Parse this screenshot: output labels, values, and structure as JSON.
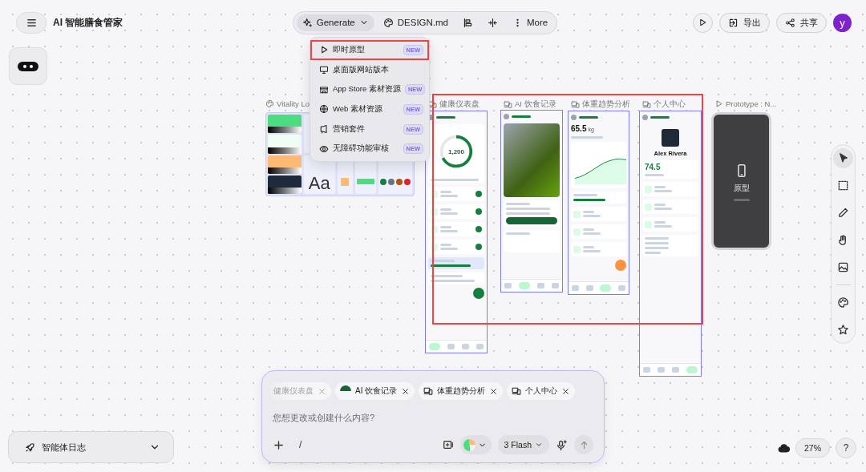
{
  "header": {
    "title": "AI 智能膳食管家"
  },
  "toolbar": [
    {
      "kind": "generate",
      "label": "Generate",
      "selected": true
    },
    {
      "kind": "file",
      "label": "DESIGN.md",
      "selected": false
    },
    {
      "kind": "align",
      "selected": false
    },
    {
      "kind": "split",
      "selected": false
    },
    {
      "kind": "more",
      "label": "More",
      "selected": false
    }
  ],
  "actions": [
    {
      "kind": "play"
    },
    {
      "kind": "export",
      "label": "导出"
    },
    {
      "kind": "share",
      "label": "共享"
    },
    {
      "kind": "avatar",
      "label": "y"
    }
  ],
  "generate_menu": [
    {
      "label": "即时原型",
      "badge": "NEW",
      "highlighted": true
    },
    {
      "label": "桌面版网站版本",
      "highlighted": false
    },
    {
      "label": "App Store 素材资源",
      "badge": "NEW",
      "highlighted": false
    },
    {
      "label": "Web 素材资源",
      "badge": "NEW",
      "highlighted": false
    },
    {
      "label": "营销套件",
      "badge": "NEW",
      "highlighted": false
    },
    {
      "label": "无障碍功能审核",
      "badge": "NEW",
      "highlighted": false
    }
  ],
  "canvas": {
    "design_board": {
      "title": "Vitality Lo",
      "type_samples": [
        "Aa"
      ],
      "swatches": [
        {
          "color": "#4ade80"
        },
        {
          "color": "#f0fdf4"
        },
        {
          "color": "#fdba74"
        },
        {
          "color": "#1e293b"
        }
      ],
      "status_dots": [
        {
          "color": "#15803d"
        },
        {
          "color": "#6b7280"
        },
        {
          "color": "#b45309"
        },
        {
          "color": "#dc2626"
        }
      ]
    },
    "screens": [
      {
        "kind": "dashboard",
        "title": "健康仪表盘",
        "selected": true,
        "value": "1,200",
        "nav": [
          {
            "selected": true
          },
          {
            "selected": false
          },
          {
            "selected": false
          },
          {
            "selected": false
          }
        ]
      },
      {
        "kind": "food",
        "title": "AI 饮食记录",
        "selected": true,
        "nav": [
          {
            "selected": false
          },
          {
            "selected": true
          },
          {
            "selected": false
          },
          {
            "selected": false
          }
        ]
      },
      {
        "kind": "weight",
        "title": "体重趋势分析",
        "selected": true,
        "value": "65.5",
        "unit": "kg",
        "nav": [
          {
            "selected": false
          },
          {
            "selected": false
          },
          {
            "selected": true
          },
          {
            "selected": false
          }
        ]
      },
      {
        "kind": "profile",
        "title": "个人中心",
        "selected": true,
        "name": "Alex Rivera",
        "value": "74.5",
        "nav": [
          {
            "selected": false
          },
          {
            "selected": false
          },
          {
            "selected": false
          },
          {
            "selected": true
          }
        ]
      },
      {
        "kind": "prototype",
        "title": "Prototype : N...",
        "selected": false,
        "label": "原型"
      }
    ]
  },
  "tools": [
    {
      "kind": "pointer",
      "selected": true
    },
    {
      "kind": "frame",
      "selected": false
    },
    {
      "kind": "pen",
      "selected": false
    },
    {
      "kind": "hand",
      "selected": false
    },
    {
      "kind": "image",
      "selected": false
    },
    {
      "kind": "palette",
      "selected": false
    },
    {
      "kind": "star",
      "selected": false
    }
  ],
  "agent_log": {
    "label": "智能体日志"
  },
  "composer": {
    "chips": [
      {
        "kind": "faded",
        "label": "健康仪表盘"
      },
      {
        "kind": "thumbnail",
        "label": "AI 饮食记录"
      },
      {
        "kind": "screen",
        "label": "体重趋势分析"
      },
      {
        "kind": "screen",
        "label": "个人中心"
      }
    ],
    "placeholder": "您想更改或创建什么内容?",
    "slash": "/",
    "model": "3 Flash"
  },
  "footer": {
    "zoom": "27%",
    "help": "?"
  }
}
